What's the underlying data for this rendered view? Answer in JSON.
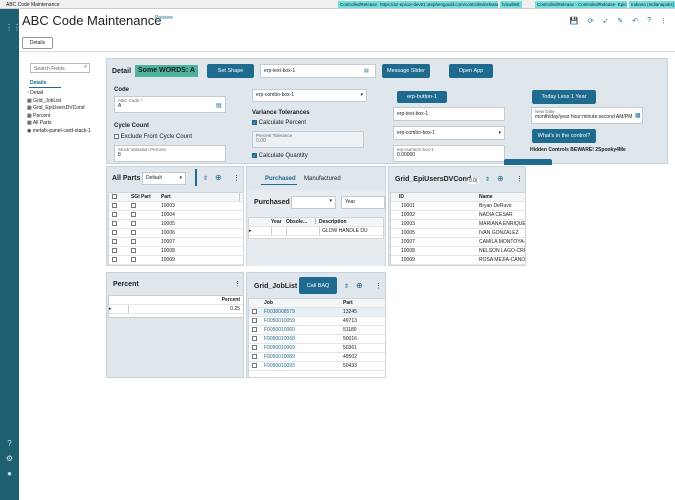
{
  "topbar": {
    "tab_title": "ABC Code Maintenance",
    "env": "ControlledRelease",
    "url": "https://az-epicor-dev01.stephengould.com/controlledrelease",
    "user": "hmwillett",
    "company": "ControlledRelease - ControlledRelease- EpicorKinetl",
    "site": "Indiana (Indianapolis)"
  },
  "header": {
    "title": "ABC Code Maintenance",
    "badge": "Preview",
    "details_button": "Details"
  },
  "sidebar": {
    "search_placeholder": "Search Fields",
    "root": "Details",
    "items": [
      "Detail",
      "Grid_JobList",
      "Grid_EpiUsersDVCond",
      "Percent",
      "All Parts",
      "metafx-panel-card-stack-1"
    ]
  },
  "detail": {
    "title": "Detail",
    "words_badge": "Some WORDS: A",
    "set_shape_button": "Set Shape",
    "text_box_1": "erp-text-box-1",
    "message_slider_button": "Message Slider",
    "open_app_button": "Open App",
    "code_heading": "Code",
    "abc_code_label": "ABC Code *",
    "abc_code_value": "A",
    "cycle_count_heading": "Cycle Count",
    "exclude_label": "Exclude From Cycle Count",
    "stock_valuation_label": "Stock Valuation Percent",
    "stock_valuation_value": "8",
    "combo_box_1": "erp-combo-box-1",
    "variance_heading": "Variance Tolerances",
    "calc_percent_label": "Calculate Percent",
    "percent_tolerance_label": "Percent Tolerance",
    "percent_tolerance_value": "0.00",
    "calc_quantity_label": "Calculate Quantity",
    "erp_button_1": "erp-button-1",
    "text_box_1b": "erp-text-box-1",
    "combo_box_1b": "erp-combo-box-1",
    "numeric_label": "erp-numeric-box-1",
    "numeric_value": "0.00000",
    "today_button": "Today Less 1 Year",
    "new_date_label": "New Date",
    "new_date_value": "month/day/year hour:minute:second AM/PM",
    "whats_button": "What's in the control?",
    "hidden_controls": "Hidden Controls BEWARE! 2Spooky4Me"
  },
  "all_parts": {
    "title": "All Parts",
    "filter": "Default",
    "col_sgi": "SGI Part",
    "col_part": "Part",
    "rows": [
      "10003",
      "10004",
      "10005",
      "10006",
      "10007",
      "10008",
      "10009"
    ]
  },
  "purchased": {
    "tab_purchased": "Purchased",
    "tab_manufactured": "Manufactured",
    "title": "Purchased",
    "year_label": "Year",
    "col_year": "Year",
    "col_obsolete": "Obsole...",
    "col_desc": "Description",
    "desc_value": "GLOW HANDLE DU"
  },
  "grid_epi": {
    "title": "Grid_EpiUsersDVCond",
    "value": "0.0(",
    "col_id": "ID",
    "col_name": "Name",
    "rows": [
      {
        "id": "10001",
        "name": "Bryan DeRuvo"
      },
      {
        "id": "10002",
        "name": "NADIA CESAR"
      },
      {
        "id": "10003",
        "name": "MARIANA ENRIQUEZ"
      },
      {
        "id": "10005",
        "name": "IVAN GONZALEZ"
      },
      {
        "id": "10007",
        "name": "CAMILA MONTOYA-C"
      },
      {
        "id": "10008",
        "name": "NELSON LAGO-CRU"
      },
      {
        "id": "10009",
        "name": "ROSA MEJIA-CANOS"
      }
    ]
  },
  "percent": {
    "title": "Percent",
    "col": "Percent",
    "value": "0.25"
  },
  "joblist": {
    "title": "Grid_JobList",
    "call_baq_button": "Call BAQ",
    "col_job": "Job",
    "col_part": "Part",
    "rows": [
      {
        "job": "F0038008579",
        "part": "13245"
      },
      {
        "job": "F0050010059",
        "part": "49713"
      },
      {
        "job": "F0050010060",
        "part": "51180"
      },
      {
        "job": "F0050010068",
        "part": "50016"
      },
      {
        "job": "F0050010069",
        "part": "50361"
      },
      {
        "job": "F0050010089",
        "part": "49502"
      },
      {
        "job": "F0050010093",
        "part": "50433"
      }
    ]
  }
}
